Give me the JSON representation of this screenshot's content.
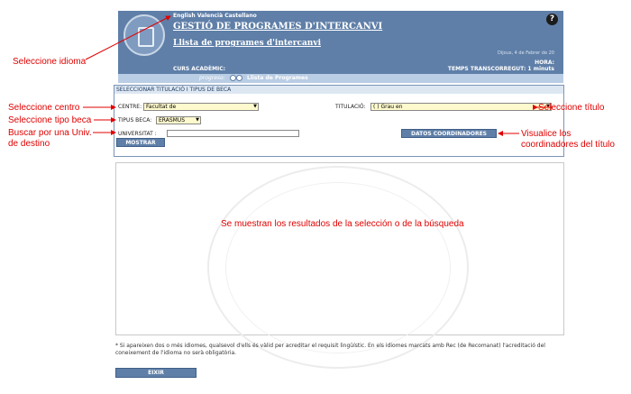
{
  "header": {
    "languages": "English Valencià Castellano",
    "title": "GESTIÓ DE PROGRAMES D'INTERCANVI",
    "subtitle": "Llista de programes d'intercanvi",
    "date": "Dijous, 4 de Febrer de 20",
    "hora_label": "HORA:",
    "temps": "TEMPS TRANSCORREGUT: 1 minuts",
    "curs_label": "CURS ACADÈMIC:",
    "help": "?"
  },
  "progress": {
    "label": "progreso:",
    "step": "Llista de Programes"
  },
  "selection": {
    "title": "SELECCIONAR TITULACIÓ I TIPUS DE BECA",
    "centre_label": "CENTRE:",
    "centre_value": "Facultat de",
    "titulacio_label": "TITULACIÓ:",
    "titulacio_value": "(      ) Grau en",
    "tipus_label": "TIPUS BECA:",
    "tipus_value": "ERASMUS",
    "universitat_label": "UNIVERSITAT :",
    "universitat_value": "",
    "mostrar_button": "MOSTRAR",
    "coordinadors_button": "DATOS COORDINADORES"
  },
  "results": {
    "message": "Se muestran los resultados de la selección o de la búsqueda"
  },
  "footnote": "* Si apareixen dos o més idiomes, qualsevol d'ells és vàlid per acreditar el requisit lingüístic. En els idiomes marcats amb Rec (de Recomanat) l'acreditació del coneixement de l'idioma no serà obligatòria.",
  "exit_button": "EIXIR",
  "annotations": {
    "idioma": "Seleccione idioma",
    "centro": "Seleccione centro",
    "tipo_beca": "Seleccione tipo beca",
    "buscar_1": "Buscar por una Univ.",
    "buscar_2": "de destino",
    "titulo": "Seleccione título",
    "visualice_1": "Visualice los",
    "visualice_2": "coordinadores del título"
  },
  "colors": {
    "header_bg": "#5f7fa8",
    "annotation": "#e00000",
    "select_bg": "#fffacd"
  }
}
